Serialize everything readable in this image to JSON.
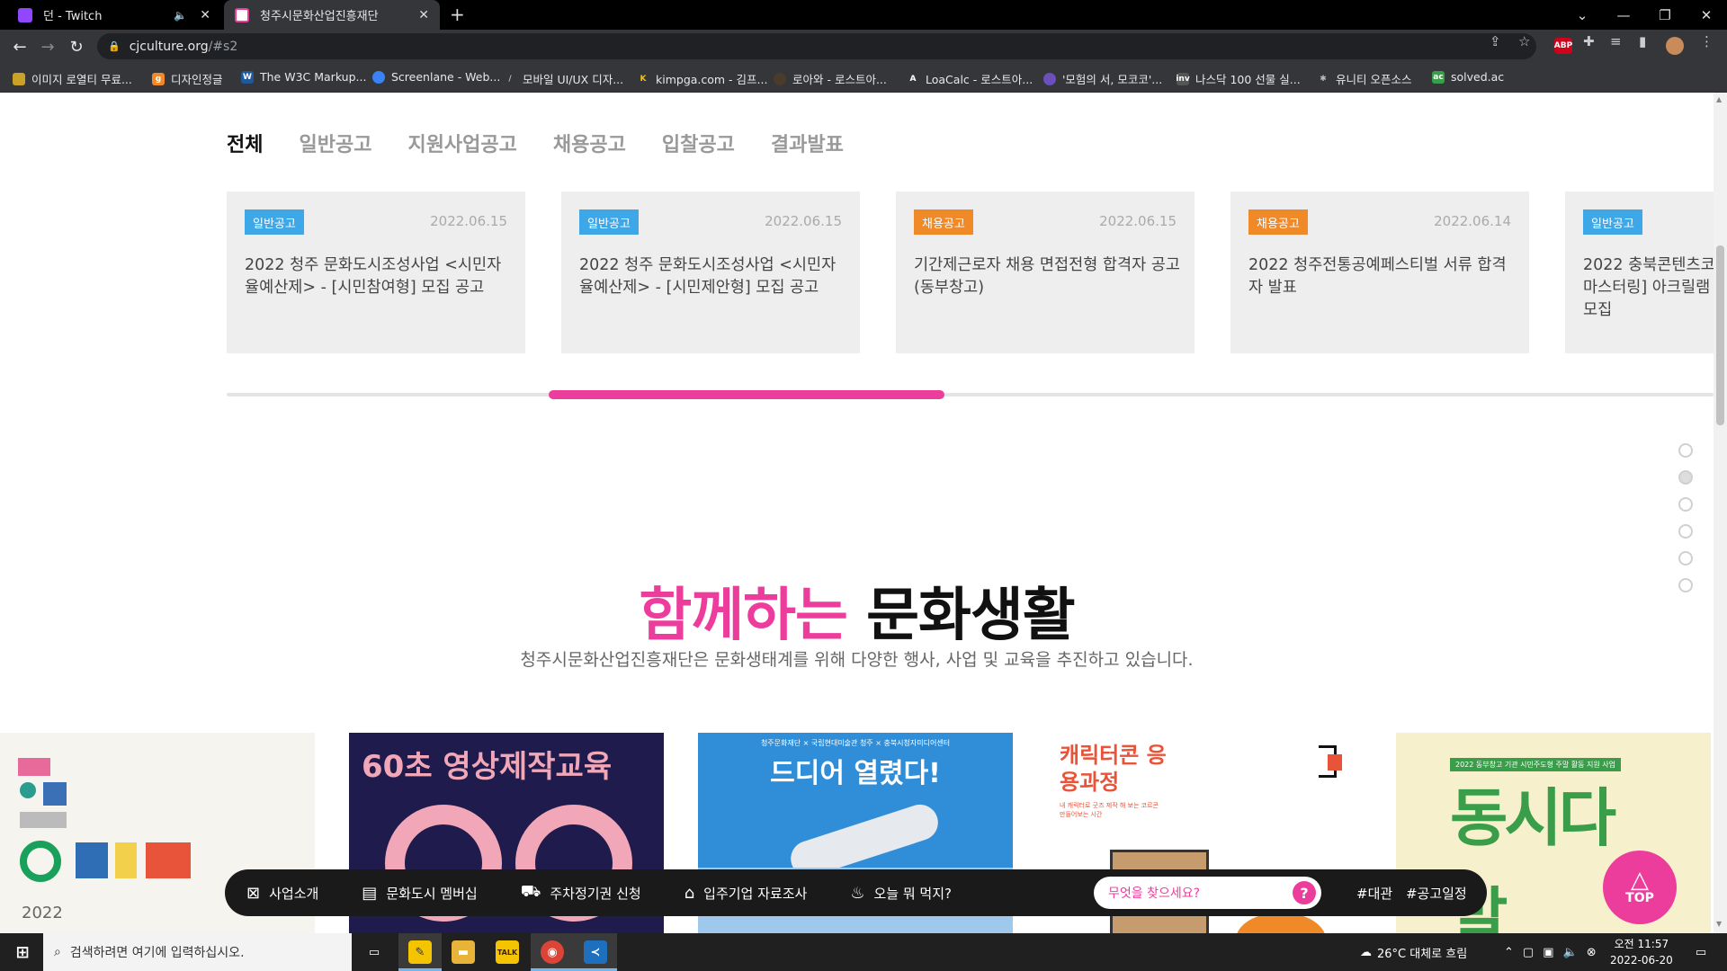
{
  "browser": {
    "tabs": [
      {
        "label": "던 - Twitch",
        "muted_icon": "speaker-icon"
      },
      {
        "label": "청주시문화산업진흥재단"
      }
    ],
    "url_host": "cjculture.org",
    "url_path": "/#s2",
    "bookmarks": [
      "이미지 로열티 무료...",
      "디자인정글",
      "The W3C Markup...",
      "Screenlane - Web...",
      "모바일 UI/UX 디자...",
      "kimpga.com - 김프...",
      "로아와 - 로스트아...",
      "LoaCalc - 로스트아...",
      "'모험의 서, 모코코'...",
      "나스닥 100 선물 실...",
      "유니티 오픈소스",
      "solved.ac"
    ],
    "ext_abp": "ABP"
  },
  "notice": {
    "tabs": [
      "전체",
      "일반공고",
      "지원사업공고",
      "채용공고",
      "입찰공고",
      "결과발표"
    ],
    "cards": [
      {
        "badge": "일반공고",
        "badge_color": "#3ea7e8",
        "date": "2022.06.15",
        "title": "2022 청주 문화도시조성사업 <시민자율예산제> - [시민참여형] 모집 공고"
      },
      {
        "badge": "일반공고",
        "badge_color": "#3ea7e8",
        "date": "2022.06.15",
        "title": "2022 청주 문화도시조성사업 <시민자율예산제> - [시민제안형] 모집 공고"
      },
      {
        "badge": "채용공고",
        "badge_color": "#f08a28",
        "date": "2022.06.15",
        "title": "기간제근로자 채용 면접전형 합격자 공고(동부창고)"
      },
      {
        "badge": "채용공고",
        "badge_color": "#f08a28",
        "date": "2022.06.14",
        "title": "2022 청주전통공예페스티벌 서류 합격자 발표"
      },
      {
        "badge": "일반공고",
        "badge_color": "#3ea7e8",
        "date": "",
        "title": "2022 충북콘텐츠코 마스터링] 아크릴램 모집"
      }
    ],
    "scroll_progress_percent": 27
  },
  "culture": {
    "heading_pink": "함께하는",
    "heading_black": "문화생활",
    "subtitle": "청주시문화산업진흥재단은 문화생태계를 위해 다양한 행사, 사업 및 교육을 추진하고 있습니다.",
    "posters": [
      {
        "text": "2022"
      },
      {
        "text": "60초 영상제작교육"
      },
      {
        "top": "청주문화재단 × 국립현대미술관 청주 × 충북시청자미디어센터",
        "text": "드디어 열렸다!"
      },
      {
        "text": "캐릭터콘 응용과정",
        "small": "내 캐릭터로 굿즈 제작 해 보는 코르콘 만들어보는 시간"
      },
      {
        "top": "2022 동부창고 기관 시민주도형 주말 활동 지원 사업",
        "text": "동시다발"
      }
    ]
  },
  "bottom_nav": {
    "items": [
      {
        "label": "사업소개",
        "icon": "puzzle-icon"
      },
      {
        "label": "문화도시 멤버십",
        "icon": "id-card-icon"
      },
      {
        "label": "주차정기권 신청",
        "icon": "car-icon"
      },
      {
        "label": "입주기업 자료조사",
        "icon": "building-icon"
      },
      {
        "label": "오늘 뭐 먹지?",
        "icon": "chef-hat-icon"
      }
    ],
    "search_placeholder": "무엇을 찾으세요?",
    "tags": [
      "#대관",
      "#공고일정"
    ],
    "top_label": "TOP"
  },
  "taskbar": {
    "search_placeholder": "검색하려면 여기에 입력하십시오.",
    "weather": "26°C 대체로 흐림",
    "time": "오전 11:57",
    "date": "2022-06-20"
  }
}
